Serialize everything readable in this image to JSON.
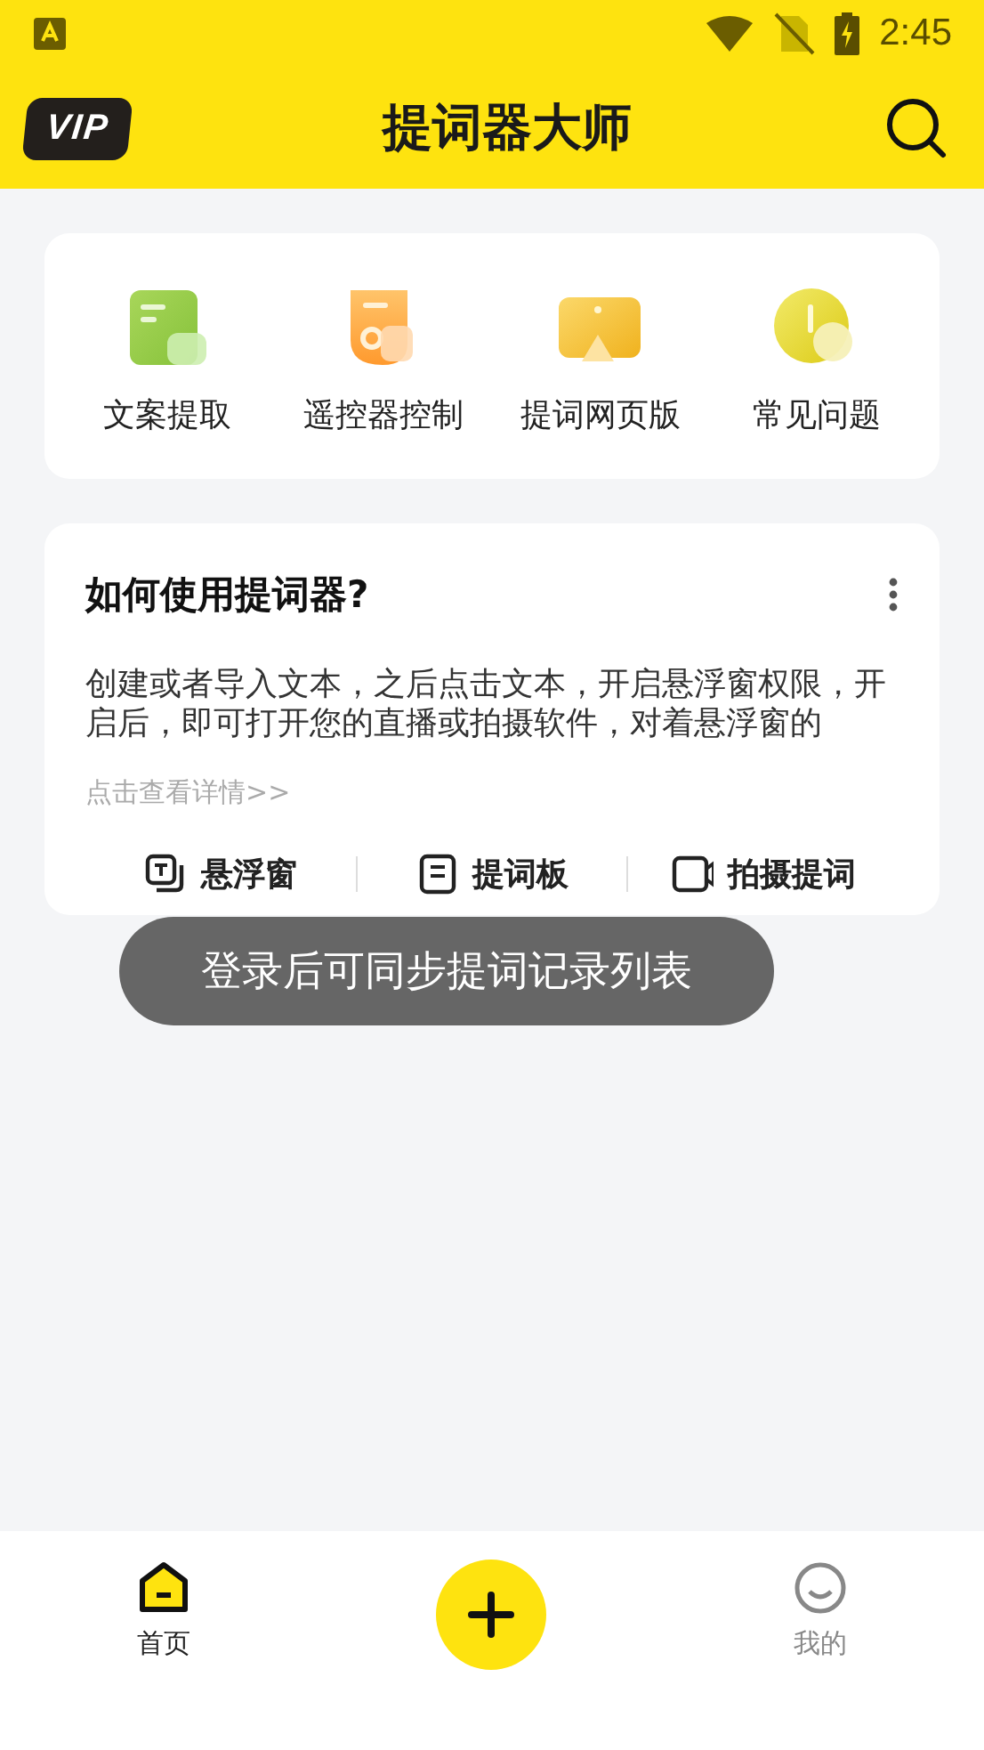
{
  "status_bar": {
    "time": "2:45"
  },
  "header": {
    "vip": "VIP",
    "title": "提词器大师"
  },
  "features": [
    {
      "label": "文案提取"
    },
    {
      "label": "遥控器控制"
    },
    {
      "label": "提词网页版"
    },
    {
      "label": "常见问题"
    }
  ],
  "guide": {
    "title": "如何使用提词器?",
    "body": "创建或者导入文本，之后点击文本，开启悬浮窗权限，开启后，即可打开您的直播或拍摄软件，对着悬浮窗的",
    "link": "点击查看详情>>",
    "actions": [
      {
        "label": "悬浮窗"
      },
      {
        "label": "提词板"
      },
      {
        "label": "拍摄提词"
      }
    ]
  },
  "toast": "登录后可同步提词记录列表",
  "bottom_nav": [
    {
      "kind": "tab",
      "label": "首页",
      "selected": true
    },
    {
      "kind": "add"
    },
    {
      "kind": "tab",
      "label": "我的",
      "selected": false
    }
  ]
}
